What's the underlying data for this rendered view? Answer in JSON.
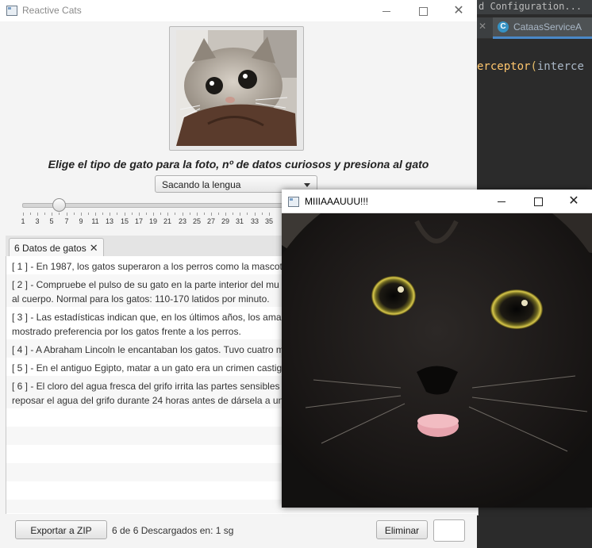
{
  "ide": {
    "top_text": "d Configuration...",
    "tab_icon_letter": "C",
    "tab_label": "CataasServiceA",
    "code_fn": "erceptor",
    "code_paren": "(",
    "code_arg": "interce"
  },
  "window": {
    "title": "Reactive Cats"
  },
  "prompt": "Elige el tipo de gato para la foto, nº de datos curiosos y presiona al gato",
  "combo": {
    "selected": "Sacando la lengua"
  },
  "slider": {
    "value": 5,
    "min": 1,
    "max": 35,
    "tick_labels": [
      "1",
      "3",
      "5",
      "7",
      "9",
      "11",
      "13",
      "15",
      "17",
      "19",
      "21",
      "23",
      "25",
      "27",
      "29",
      "31",
      "33",
      "35"
    ]
  },
  "tab": {
    "label": "6 Datos de gatos"
  },
  "facts": [
    {
      "line1": "[ 1 ] - En 1987, los gatos superaron a los perros como la mascota",
      "line2": ""
    },
    {
      "line1": "[ 2 ] - Compruebe el pulso de su gato en la parte interior del mu",
      "line2": "al cuerpo. Normal para los gatos: 110-170 latidos por minuto."
    },
    {
      "line1": "[ 3 ] - Las estadísticas indican que, en los últimos años, los amant",
      "line2": "mostrado preferencia por los gatos frente a los perros."
    },
    {
      "line1": "[ 4 ] - A Abraham Lincoln le encantaban los gatos. Tuvo cuatro m",
      "line2": ""
    },
    {
      "line1": "[ 5 ] - En el antiguo Egipto, matar a un gato era un crimen castig",
      "line2": ""
    },
    {
      "line1": "[ 6 ] - El cloro del agua fresca del grifo irrita las partes sensibles d",
      "line2": "reposar el agua del grifo durante 24 horas antes de dársela a un"
    }
  ],
  "bottom": {
    "export_label": "Exportar  a ZIP",
    "status": "6 de 6 Descargados en: 1 sg",
    "delete_label": "Eliminar",
    "extra_label": ""
  },
  "popup": {
    "title": "MIIIAAAUUU!!!"
  }
}
